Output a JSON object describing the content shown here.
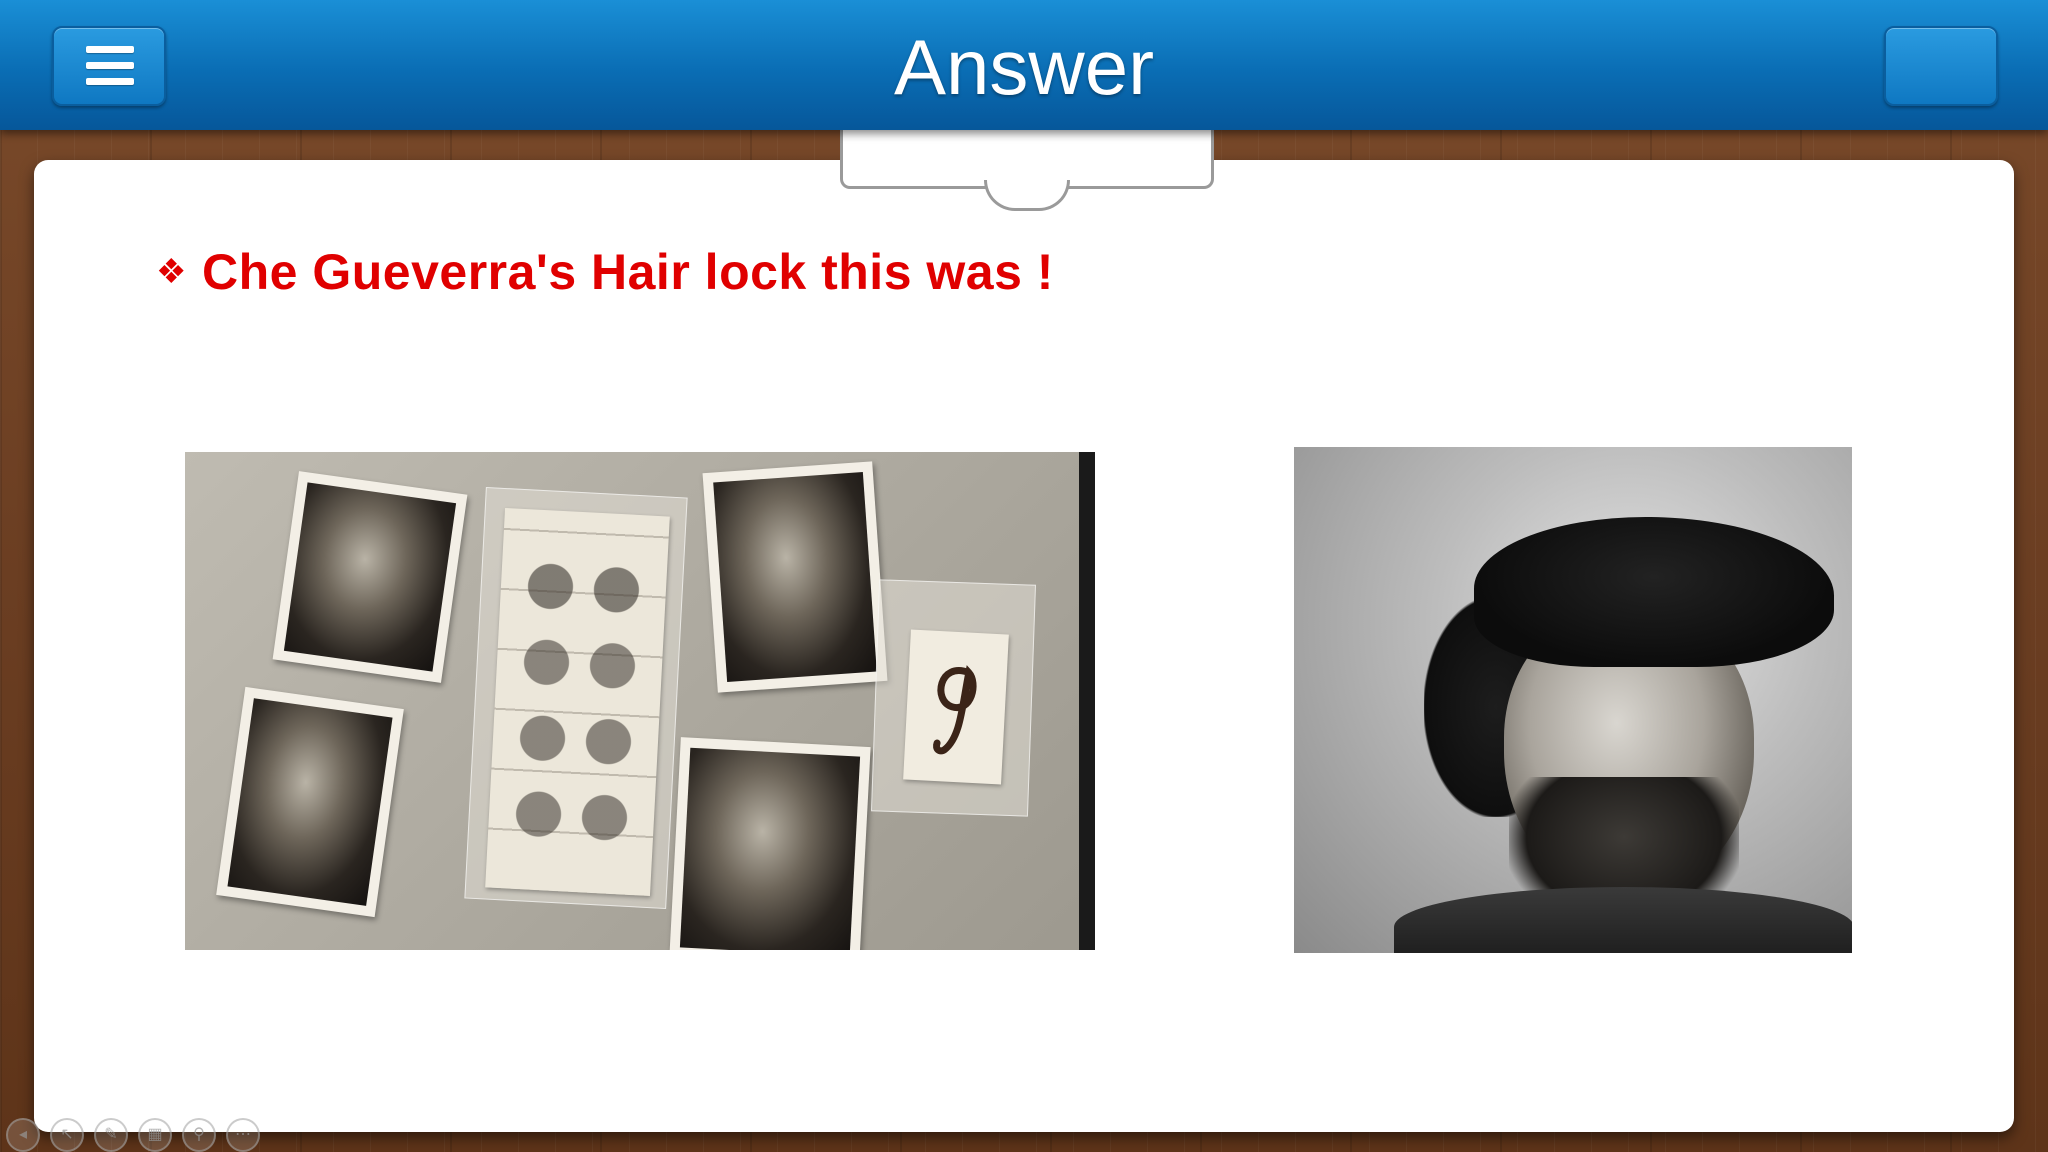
{
  "header": {
    "title": "Answer",
    "menu_icon": "hamburger-menu-icon",
    "accent_color": "#0a6db4"
  },
  "content": {
    "bullet_icon": "❖",
    "headline": "Che Gueverra's Hair lock this was !",
    "headline_color": "#e00000",
    "hair_lock_glyph": "9"
  },
  "controls": [
    {
      "icon": "previous-slide-icon",
      "glyph": "◂"
    },
    {
      "icon": "pointer-icon",
      "glyph": "↖"
    },
    {
      "icon": "pen-icon",
      "glyph": "✎"
    },
    {
      "icon": "slides-icon",
      "glyph": "▦"
    },
    {
      "icon": "zoom-icon",
      "glyph": "⚲"
    },
    {
      "icon": "more-options-icon",
      "glyph": "⋯"
    }
  ]
}
